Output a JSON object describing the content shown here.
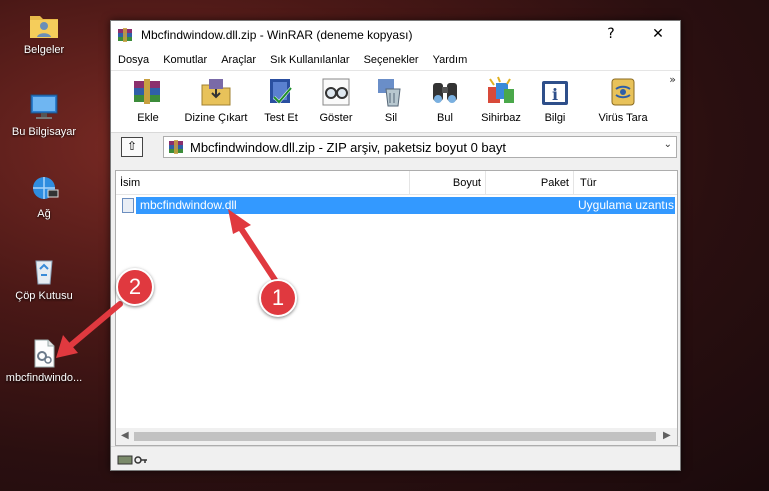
{
  "desktop": {
    "icons": [
      {
        "label": "Belgeler",
        "icon": "folder-user-icon"
      },
      {
        "label": "Bu Bilgisayar",
        "icon": "computer-icon"
      },
      {
        "label": "Ağ",
        "icon": "network-icon"
      },
      {
        "label": "Çöp Kutusu",
        "icon": "recycle-bin-icon"
      },
      {
        "label": "mbcfindwindo...",
        "icon": "dll-file-icon"
      }
    ]
  },
  "window": {
    "title": "Mbcfindwindow.dll.zip - WinRAR (deneme kopyası)",
    "help_btn": "?",
    "close_btn": "✕",
    "menu": [
      "Dosya",
      "Komutlar",
      "Araçlar",
      "Sık Kullanılanlar",
      "Seçenekler",
      "Yardım"
    ],
    "toolbar": [
      {
        "label": "Ekle",
        "icon": "add-books-icon"
      },
      {
        "label": "Dizine Çıkart",
        "icon": "extract-folder-icon"
      },
      {
        "label": "Test Et",
        "icon": "test-icon"
      },
      {
        "label": "Göster",
        "icon": "view-glasses-icon"
      },
      {
        "label": "Sil",
        "icon": "delete-icon"
      },
      {
        "label": "Bul",
        "icon": "find-binoculars-icon"
      },
      {
        "label": "Sihirbaz",
        "icon": "wizard-icon"
      },
      {
        "label": "Bilgi",
        "icon": "info-icon"
      },
      {
        "label": "Virüs Tara",
        "icon": "virus-scan-icon"
      }
    ],
    "toolbar_more": "»",
    "address": {
      "up_icon": "⇧",
      "text": "Mbcfindwindow.dll.zip - ZIP arşiv, paketsiz boyut 0 bayt"
    },
    "columns": {
      "name": "İsim",
      "size": "Boyut",
      "packed": "Paket",
      "type": "Tür"
    },
    "files": [
      {
        "name": "mbcfindwindow.dll",
        "type": "Uygulama uzantısı"
      }
    ]
  },
  "callouts": {
    "one": "1",
    "two": "2"
  },
  "colors": {
    "selection": "#3399ff",
    "callout": "#e0393f"
  }
}
